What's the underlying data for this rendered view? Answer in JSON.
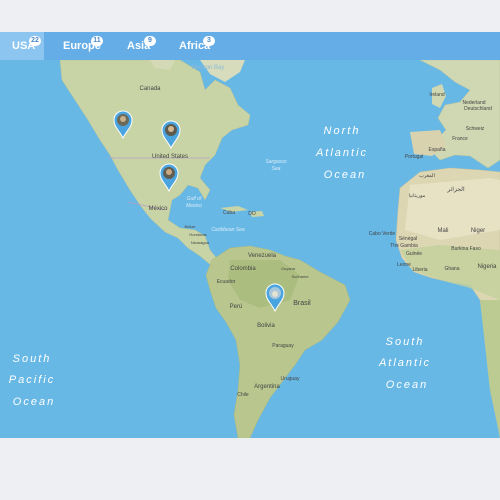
{
  "tabs": [
    {
      "label": "USA",
      "count": "22"
    },
    {
      "label": "Europe",
      "count": "11"
    },
    {
      "label": "Asia",
      "count": "9"
    },
    {
      "label": "Africa",
      "count": "3"
    }
  ],
  "colors": {
    "tab_bar": "#64ade6",
    "tab_active": "#8cc5f0",
    "ocean": "#68b8e6",
    "land": "#cdd7b1",
    "marker": "#4aa4e0"
  },
  "map": {
    "countries": {
      "canada": "Canada",
      "usa": "United States",
      "mexico": "México",
      "cuba": "Cuba",
      "do": "DO",
      "venezuela": "Venezuela",
      "colombia": "Colombia",
      "ecuador": "Ecuador",
      "peru": "Perú",
      "bolivia": "Bolivia",
      "brasil": "Brasil",
      "paraguay": "Paraguay",
      "argentina": "Argentina",
      "uruguay": "Uruguay",
      "chile": "Chile",
      "guyana": "Guyana",
      "suriname": "Suriname",
      "nicaragua": "Nicaragua",
      "honduras": "Honduras",
      "belize": "Belize",
      "espana": "España",
      "portugal": "Portugal",
      "france": "France",
      "schweiz": "Schweiz",
      "nederland": "Nederland",
      "deutschland": "Deutschland",
      "ireland": "Ireland",
      "mali": "Mali",
      "niger": "Niger",
      "cabo_verde": "Cabo Verde",
      "gambia": "The Gambia",
      "leone": "Leone",
      "liberia": "Liberia",
      "nigeria": "Nigeria",
      "algeria": "الجزائر",
      "morocco": "المغرب",
      "mauritania": "موريتانيا",
      "senegal": "Sénégal",
      "guinea": "Guinée",
      "ghana": "Ghana",
      "burkina": "Burkina Faso"
    },
    "water": {
      "hudson_bay": "Hudson Bay",
      "north_atlantic_1": "North",
      "north_atlantic_2": "Atlantic",
      "north_atlantic_3": "Ocean",
      "south_atlantic_1": "South",
      "south_atlantic_2": "Atlantic",
      "south_atlantic_3": "Ocean",
      "south_pacific_1": "South",
      "south_pacific_2": "Pacific",
      "south_pacific_3": "Ocean",
      "gulf_1": "Gulf of",
      "gulf_2": "Mexico",
      "caribbean": "Caribbean Sea",
      "sargasso_1": "Sargasso",
      "sargasso_2": "Sea"
    }
  }
}
